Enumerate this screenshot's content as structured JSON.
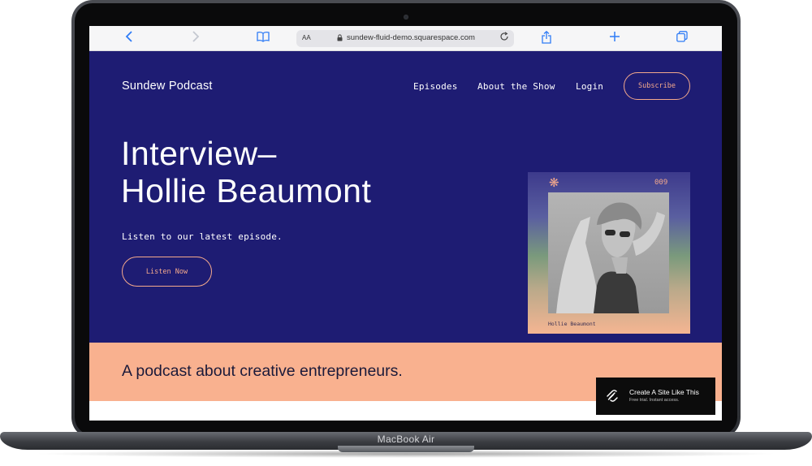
{
  "device": {
    "label": "MacBook Air"
  },
  "browser": {
    "text_size_label": "AA",
    "url": "sundew-fluid-demo.squarespace.com",
    "icons": [
      "chevron-left-icon",
      "chevron-right-icon",
      "book-icon",
      "lock-icon",
      "reload-icon",
      "share-icon",
      "plus-icon",
      "tabs-icon"
    ],
    "accent_color": "#2f7cf6"
  },
  "site": {
    "brand": "Sundew Podcast",
    "nav": {
      "episodes": "Episodes",
      "about": "About the Show",
      "login": "Login",
      "subscribe": "Subscribe"
    },
    "hero": {
      "title_line1": "Interview–",
      "title_line2": "Hollie Beaumont",
      "subtitle": "Listen to our latest episode.",
      "cta": "Listen Now"
    },
    "episode_card": {
      "symbol": "❋",
      "number": "009",
      "caption": "Hollie Beaumont",
      "image": "black-and-white portrait photo"
    },
    "tagline": "A podcast about creative entrepreneurs.",
    "colors": {
      "hero_bg": "#1e1c73",
      "accent": "#f4a98c",
      "band_bg": "#f9b18f"
    }
  },
  "promo": {
    "title": "Create A Site Like This",
    "subtitle": "Free trial. Instant access.",
    "icon": "squarespace-logo"
  }
}
